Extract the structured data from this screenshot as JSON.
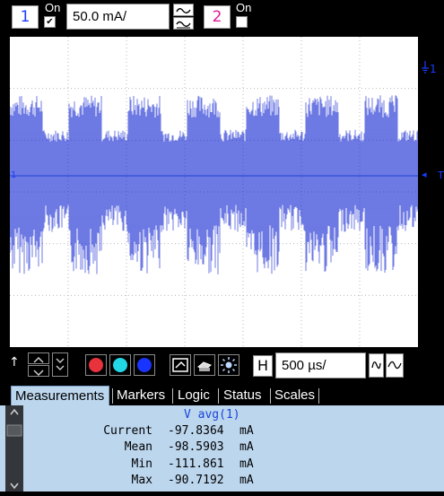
{
  "channel1": {
    "number": "1",
    "on_label": "On",
    "checked": "✔",
    "scale_value": "50.0 mA/",
    "color": "#1a3cff"
  },
  "channel2": {
    "number": "2",
    "on_label": "On",
    "checked": "",
    "color": "#e0199a"
  },
  "right_markers": {
    "ch1_marker": "1",
    "trigger_marker": "T"
  },
  "left_marker": "1",
  "timebase": {
    "label": "H",
    "value": "500 µs/"
  },
  "waveform": {
    "color": "#0a1ed0",
    "grid_color": "#b8b8b8"
  },
  "toolbar": {
    "colors": [
      "#e8323c",
      "#22d6e6",
      "#1a34ff"
    ]
  },
  "tabs": {
    "measurements": "Measurements",
    "markers": "Markers",
    "logic": "Logic",
    "status": "Status",
    "scales": "Scales"
  },
  "measurements": {
    "title": "V avg(1)",
    "rows": [
      {
        "label": "Current",
        "value": "-97.8364",
        "unit": "mA"
      },
      {
        "label": "Mean",
        "value": "-98.5903",
        "unit": "mA"
      },
      {
        "label": "Min",
        "value": "-111.861",
        "unit": "mA"
      },
      {
        "label": "Max",
        "value": "-90.7192",
        "unit": "mA"
      }
    ]
  }
}
